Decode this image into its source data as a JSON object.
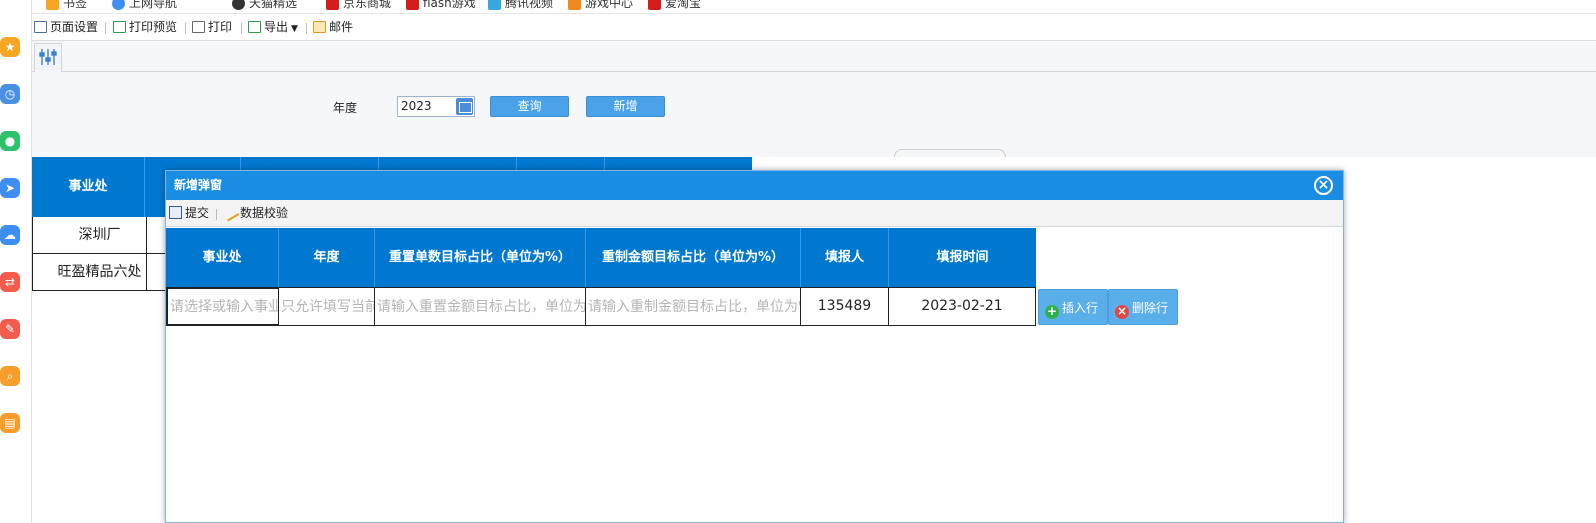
{
  "bookmarks": [
    {
      "label": "书签",
      "icon": "star-icon"
    },
    {
      "label": "上网导航",
      "icon": "compass-icon"
    },
    {
      "label": "天猫精选",
      "icon": "tmall-icon"
    },
    {
      "label": "京东商城",
      "icon": "jd-icon"
    },
    {
      "label": "flash游戏",
      "icon": "game-icon"
    },
    {
      "label": "腾讯视频",
      "icon": "video-icon"
    },
    {
      "label": "游戏中心",
      "icon": "game-center-icon"
    },
    {
      "label": "爱淘宝",
      "icon": "taobao-icon"
    }
  ],
  "print_toolbar": {
    "page_setup": "页面设置",
    "print_preview": "打印预览",
    "print": "打印",
    "export": "导出",
    "mail": "邮件"
  },
  "filter": {
    "year_label": "年度",
    "year_value": "2023",
    "query_button": "查询",
    "add_button": "新增"
  },
  "background_table": {
    "header_first": "事业处",
    "rows": [
      "深圳厂",
      "旺盈精品六处"
    ]
  },
  "modal": {
    "title": "新增弹窗",
    "close_symbol": "×",
    "toolbar": {
      "submit": "提交",
      "validate": "数据校验"
    },
    "columns": [
      "事业处",
      "年度",
      "重置单数目标占比（单位为%）",
      "重制金额目标占比（单位为%）",
      "填报人",
      "填报时间"
    ],
    "row": {
      "division_placeholder": "请选择或输入事业处",
      "year_placeholder": "只允许填写当前年度",
      "count_ratio_placeholder": "请输入重置金额目标占比，单位为%",
      "amount_ratio_placeholder": "请输入重制金额目标占比，单位为%",
      "reporter": "135489",
      "report_time": "2023-02-21"
    },
    "insert_row": "插入行",
    "delete_row": "删除行"
  },
  "colors": {
    "header_blue": "#0078d0",
    "modal_header": "#1a8de3",
    "button_blue": "#4aa3e8"
  }
}
